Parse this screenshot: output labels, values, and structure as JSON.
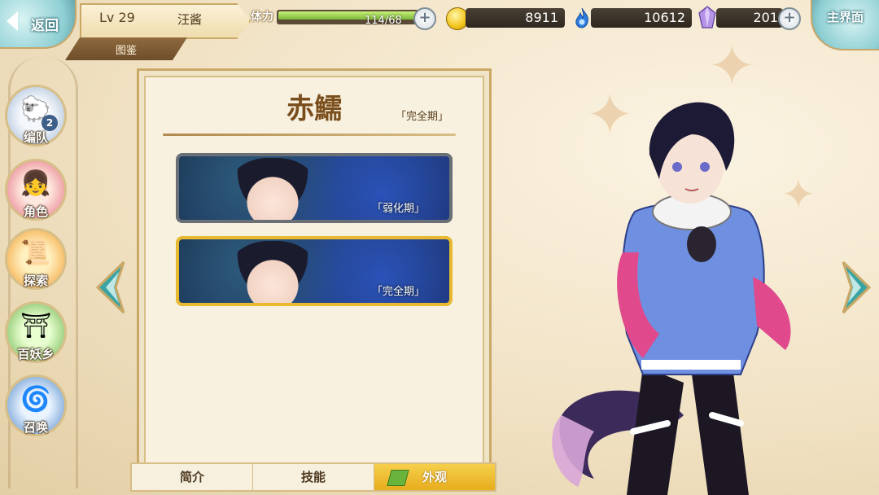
{
  "header": {
    "back_label": "返回",
    "level": "Lv 29",
    "player_name": "汪酱",
    "breadcrumb": "图鉴",
    "stamina_label": "体力",
    "stamina_text": "114/68",
    "stamina_fill_fraction": 1.0,
    "gold": "8911",
    "soul": "10612",
    "crystal": "201",
    "home_label": "主界面"
  },
  "sidebar": {
    "items": [
      {
        "label": "编队",
        "icon": "team-icon",
        "badge": "2"
      },
      {
        "label": "角色",
        "icon": "character-icon"
      },
      {
        "label": "探索",
        "icon": "explore-icon"
      },
      {
        "label": "百妖乡",
        "icon": "village-icon"
      },
      {
        "label": "召唤",
        "icon": "summon-icon"
      }
    ]
  },
  "detail": {
    "name": "赤鱬",
    "stage": "「完全期」",
    "skins": [
      {
        "label": "「弱化期」",
        "selected": false
      },
      {
        "label": "「完全期」",
        "selected": true
      }
    ]
  },
  "tabs": [
    "简介",
    "技能",
    "外观"
  ],
  "active_tab": "外观",
  "colors": {
    "gold_accent": "#e8b830",
    "panel_bg": "#f8f1e0",
    "frame": "#caa968",
    "name_color": "#7a4e1d"
  }
}
